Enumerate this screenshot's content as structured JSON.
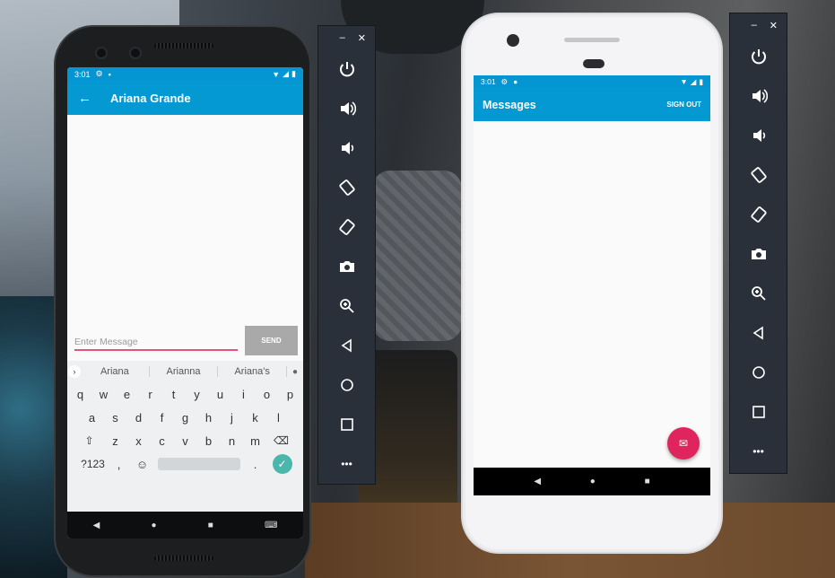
{
  "device1": {
    "status": {
      "time": "3:01",
      "icons": [
        "settings-icon",
        "sd-card-icon",
        "wifi-icon",
        "signal-icon",
        "battery-icon"
      ]
    },
    "appbar": {
      "back_glyph": "←",
      "title": "Ariana Grande"
    },
    "compose": {
      "placeholder": "Enter Message",
      "send_label": "SEND"
    },
    "keyboard": {
      "suggestions": [
        "Ariana",
        "Arianna",
        "Ariana's"
      ],
      "row1": [
        "q",
        "w",
        "e",
        "r",
        "t",
        "y",
        "u",
        "i",
        "o",
        "p"
      ],
      "row2": [
        "a",
        "s",
        "d",
        "f",
        "g",
        "h",
        "j",
        "k",
        "l"
      ],
      "row3": [
        "z",
        "x",
        "c",
        "v",
        "b",
        "n",
        "m"
      ],
      "row4": {
        "symbols": "?123",
        "comma": ",",
        "period": "."
      }
    },
    "nav": [
      "◀",
      "●",
      "■",
      "⌨"
    ]
  },
  "toolbar1": {
    "minimize": "–",
    "close": "✕",
    "more": "•••"
  },
  "toolbar2": {
    "minimize": "–",
    "close": "✕",
    "more": "•••"
  },
  "device2": {
    "status": {
      "time": "3:01"
    },
    "appbar": {
      "title": "Messages",
      "signout": "SIGN OUT"
    },
    "nav": [
      "◀",
      "●",
      "■"
    ]
  }
}
